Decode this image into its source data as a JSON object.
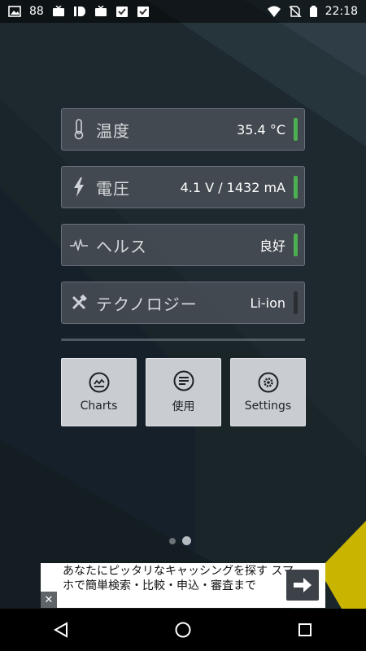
{
  "status_bar": {
    "left_number": "88",
    "time": "22:18",
    "left_icons": [
      "image-icon",
      "tv-icon",
      "id-icon",
      "tv-icon",
      "clipboard-check-icon",
      "clipboard-check-icon"
    ],
    "right_icons": [
      "wifi-icon",
      "no-sim-icon",
      "battery-icon"
    ]
  },
  "rows": [
    {
      "label": "温度",
      "value": "35.4 °C",
      "icon": "thermometer-icon",
      "indicator": "#4caf50"
    },
    {
      "label": "電圧",
      "value": "4.1 V / 1432 mA",
      "icon": "lightning-icon",
      "indicator": "#4caf50"
    },
    {
      "label": "ヘルス",
      "value": "良好",
      "icon": "pulse-icon",
      "indicator": "#4caf50"
    },
    {
      "label": "テクノロジー",
      "value": "Li-ion",
      "icon": "tools-icon",
      "indicator": "#2b2f33"
    }
  ],
  "tiles": [
    {
      "label": "Charts",
      "icon": "chart-icon"
    },
    {
      "label": "使用",
      "icon": "list-icon"
    },
    {
      "label": "Settings",
      "icon": "gear-icon"
    }
  ],
  "pager": {
    "count": 2,
    "active": 1
  },
  "ad": {
    "text": "あなたにピッタリなキャッシングを探す スマホで簡単検索・比較・申込・審査まで",
    "close_label": "✕",
    "arrow_icon": "arrow-right-icon"
  },
  "nav": {
    "back": "back-icon",
    "home": "home-icon",
    "recents": "recents-icon"
  },
  "colors": {
    "row_bg": "#4b5058",
    "tile_bg": "#c9ccd1",
    "indicator_ok": "#4caf50",
    "indicator_off": "#2b2f33"
  }
}
